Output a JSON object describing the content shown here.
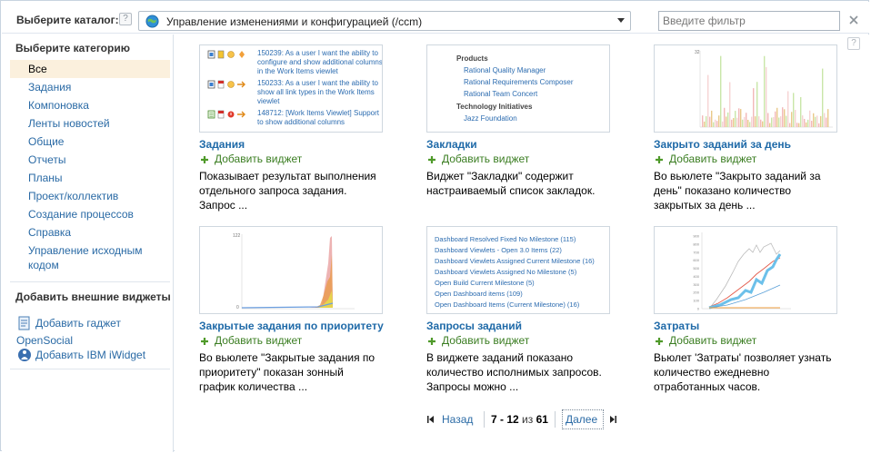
{
  "topbar": {
    "catalog_label": "Выберите каталог:",
    "help_glyph": "?",
    "catalog_value": "Управление изменениями и конфигурацией (/ccm)",
    "filter_placeholder": "Введите фильтр",
    "icons": [
      "help-icon",
      "globe-icon",
      "dropdown-arrow-icon",
      "close-icon"
    ]
  },
  "sidebar": {
    "heading": "Выберите категорию",
    "categories": [
      "Все",
      "Задания",
      "Компоновка",
      "Ленты новостей",
      "Общие",
      "Отчеты",
      "Планы",
      "Проект/коллектив",
      "Создание процессов",
      "Справка",
      "Управление исходным кодом"
    ],
    "selected_category": "Все",
    "external_heading": "Добавить внешние виджеты",
    "external_links": {
      "gadget": "Добавить гаджет",
      "opensocial": "OpenSocial",
      "iwidget": "Добавить IBM iWidget"
    }
  },
  "main": {
    "help_glyph": "?",
    "add_label": "Добавить виджет",
    "cards": [
      {
        "title": "Задания",
        "description": "Показывает результат выполнения отдельного запроса задания. Запрос ...",
        "thumb": {
          "rows": [
            "150239: As a user I want the ability to configure and show additional columns in the Work Items viewlet",
            "150233: As a user I want the ability to show all link types in the Work Items viewlet",
            "148712: [Work Items Viewlet] Support to show additional columns"
          ]
        }
      },
      {
        "title": "Закладки",
        "description": "Виджет \"Закладки\" содержит настраиваемый список закладок.",
        "thumb": {
          "section1": "Products",
          "items1": [
            "Rational Quality Manager",
            "Rational Requirements Composer",
            "Rational Team Concert"
          ],
          "section2": "Technology Initiatives",
          "items2": [
            "Jazz Foundation"
          ]
        }
      },
      {
        "title": "Закрыто заданий за день",
        "description": "Во вьюлете \"Закрыто заданий за день\" показано количество закрытых за день ...",
        "thumb": {
          "y_label": "32"
        }
      },
      {
        "title": "Закрытые задания по приоритету",
        "description": "Во вьюлете \"Закрытые задания по приоритету\" показан зонный график количества ...",
        "thumb": {
          "y_top": "122",
          "y_bottom": "0"
        }
      },
      {
        "title": "Запросы заданий",
        "description": "В виджете заданий показано количество исполнимых запросов. Запросы можно ...",
        "thumb": {
          "queries": [
            "Dashboard Resolved Fixed No Milestone (115)",
            "Dashboard Viewlets - Open 3.0 Items (22)",
            "Dashboard Viewlets Assigned Current Milestone (16)",
            "Dashboard Viewlets Assigned No Milestone (5)",
            "Open Build Current Milestone (5)",
            "Open Dashboard items (109)",
            "Open Dashboard Items (Current Milestone) (16)"
          ]
        }
      },
      {
        "title": "Затраты",
        "description": "Вьюлет 'Затраты' позволяет узнать количество ежедневно отработанных часов.",
        "thumb": {
          "y_ticks": [
            "900",
            "800",
            "700",
            "600",
            "500",
            "400",
            "300",
            "200",
            "100",
            "0"
          ]
        }
      }
    ],
    "pager": {
      "prev": "Назад",
      "range": "7 - 12",
      "of": "из",
      "total": "61",
      "next": "Далее"
    }
  },
  "colors": {
    "link": "#2a6aa5",
    "title": "#1f6aa8",
    "add_green": "#3a7d21",
    "selected_bg": "#fbf0dd",
    "border": "#c8d4e0"
  }
}
